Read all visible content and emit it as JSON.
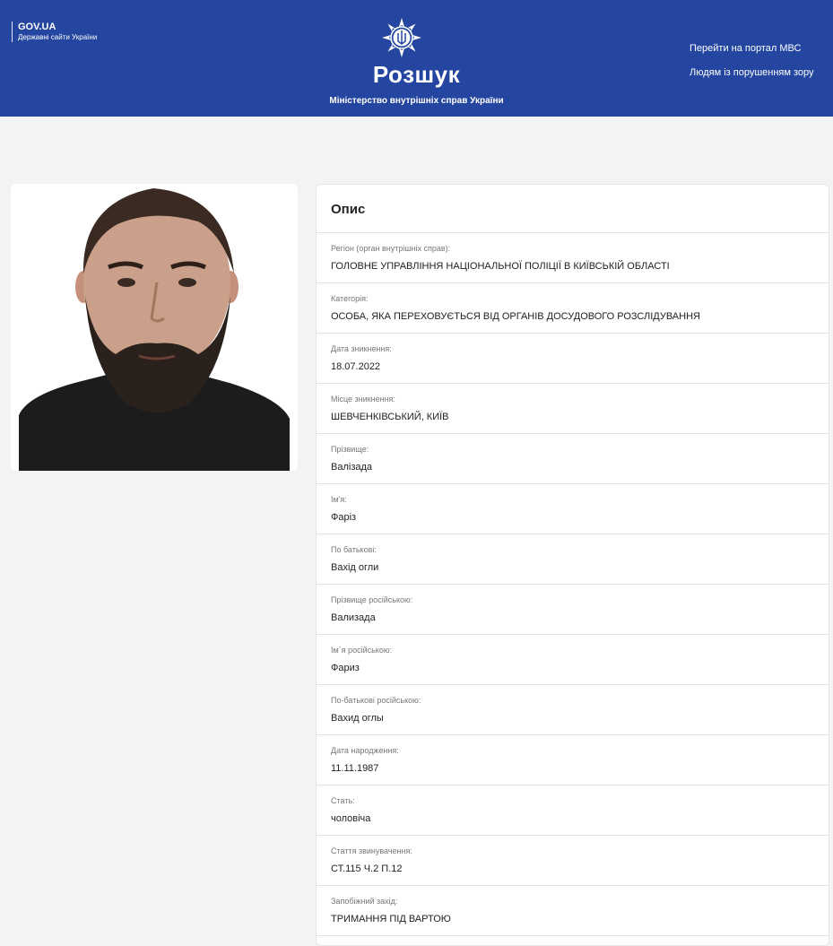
{
  "header": {
    "gov_title": "GOV.UA",
    "gov_subtitle": "Державні сайти України",
    "site_title": "Розшук",
    "site_subtitle": "Міністерство внутрішніх справ України",
    "links": [
      "Перейти на портал МВС",
      "Людям із порушенням зору"
    ],
    "bg_color": "#2446a0"
  },
  "photo": {
    "icon": "person-photo"
  },
  "description": {
    "title": "Опис",
    "rows": [
      {
        "label": "Регіон (орган внутрішніх справ):",
        "value": "ГОЛОВНЕ УПРАВЛІННЯ НАЦІОНАЛЬНОЇ ПОЛІЦІЇ В КИЇВСЬКІЙ ОБЛАСТІ"
      },
      {
        "label": "Категорія:",
        "value": "ОСОБА, ЯКА ПЕРЕХОВУЄТЬСЯ ВІД ОРГАНІВ ДОСУДОВОГО РОЗСЛІДУВАННЯ"
      },
      {
        "label": "Дата зникнення:",
        "value": "18.07.2022"
      },
      {
        "label": "Місце зникнення:",
        "value": "ШЕВЧЕНКІВСЬКИЙ, КИЇВ"
      },
      {
        "label": "Прізвище:",
        "value": "Валізада"
      },
      {
        "label": "Ім'я:",
        "value": "Фаріз"
      },
      {
        "label": "По батькові:",
        "value": "Вахід огли"
      },
      {
        "label": "Прізвище російською:",
        "value": "Вализада"
      },
      {
        "label": "Ім`я російською:",
        "value": "Фариз"
      },
      {
        "label": "По-батькові російською:",
        "value": "Вахид оглы"
      },
      {
        "label": "Дата народження:",
        "value": "11.11.1987"
      },
      {
        "label": "Стать:",
        "value": "чоловіча"
      },
      {
        "label": "Стаття звинувачення:",
        "value": "СТ.115 Ч.2 П.12"
      },
      {
        "label": "Запобіжний захід:",
        "value": "ТРИМАННЯ ПІД ВАРТОЮ"
      }
    ]
  }
}
